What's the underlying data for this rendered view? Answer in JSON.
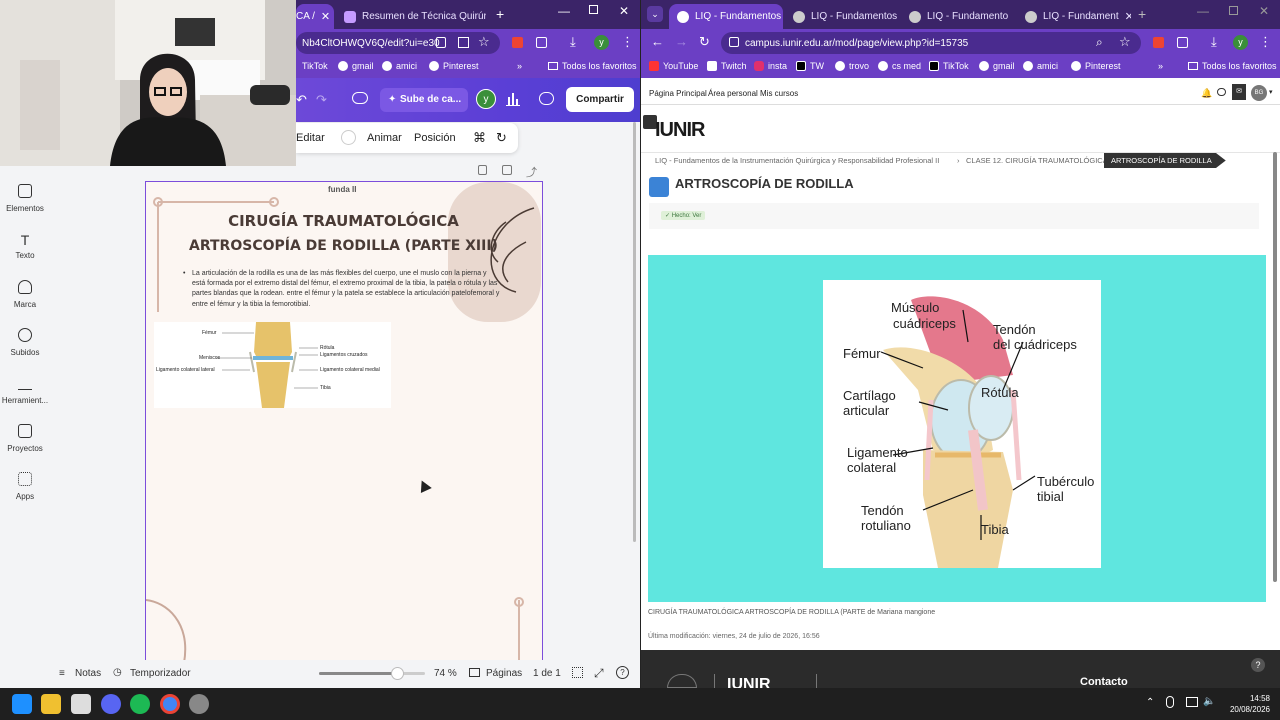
{
  "left_browser": {
    "tabs": [
      {
        "label": "CA /"
      },
      {
        "label": "Resumen de Técnica Quirúrgica"
      }
    ],
    "new_tab": "+",
    "address": "Nb4CltOHWQV6Q/edit?ui=e30",
    "profile": "y",
    "bookmarks": [
      "TikTok",
      "gmail",
      "amici",
      "Pinterest"
    ],
    "all_bookmarks": "Todos los favoritos"
  },
  "canva": {
    "upload_label": "Sube de ca...",
    "avatar": "y",
    "share_label": "Compartir",
    "edit_label": "Editar",
    "animate_label": "Animar",
    "position_label": "Posición",
    "sidebar": [
      {
        "label": "Elementos",
        "icon": "elements-icon"
      },
      {
        "label": "Texto",
        "icon": "text-icon"
      },
      {
        "label": "Marca",
        "icon": "brand-icon"
      },
      {
        "label": "Subidos",
        "icon": "uploads-icon"
      },
      {
        "label": "Herramient...",
        "icon": "tools-icon"
      },
      {
        "label": "Proyectos",
        "icon": "projects-icon"
      },
      {
        "label": "Apps",
        "icon": "apps-icon"
      }
    ],
    "page": {
      "header": "funda II",
      "title_line1": "CIRUGÍA TRAUMATOLÓGICA",
      "title_line2": "ARTROSCOPÍA DE RODILLA (PARTE XIII)",
      "bullet": "La articulación de la rodilla es una de las más flexibles del cuerpo, une el muslo con la pierna y está formada por el extremo distal del fémur, el extremo proximal de la tibia, la patela o rótula y las partes blandas que la rodean. entre el fémur y la patela se establece la articulación patelofemoral y entre el fémur y la tibia la femorotibial.",
      "diagram_labels": {
        "femur": "Fémur",
        "meniscos": "Meniscos",
        "lig_col_lat": "Ligamento colateral lateral",
        "rotula": "Rótula",
        "lig_cruzados": "Ligamentos cruzados",
        "lig_col_med": "Ligamento colateral medial",
        "tibia": "Tibia"
      }
    },
    "bottom": {
      "notes": "Notas",
      "timer": "Temporizador",
      "zoom_value": 0.74,
      "zoom": "74 %",
      "pages": "Páginas",
      "page_count": "1 de 1"
    }
  },
  "right_browser": {
    "tabs": [
      {
        "label": "LIQ - Fundamentos"
      },
      {
        "label": "LIQ - Fundamentos"
      },
      {
        "label": "LIQ - Fundamento"
      },
      {
        "label": "LIQ - Fundament"
      }
    ],
    "new_tab": "+",
    "address": "campus.iunir.edu.ar/mod/page/view.php?id=15735",
    "profile": "y",
    "bookmarks": [
      "YouTube",
      "Twitch",
      "insta",
      "TW",
      "trovo",
      "cs med",
      "TikTok",
      "gmail",
      "amici",
      "Pinterest"
    ],
    "all_bookmarks": "Todos los favoritos"
  },
  "moodle": {
    "nav": [
      "Página Principal",
      "Área personal",
      "Mis cursos"
    ],
    "user_initials": "BG",
    "logo": "IUNIR",
    "breadcrumbs": [
      "LIQ - Fundamentos de la Instrumentación Quirúrgica y Responsabilidad Profesional II",
      "CLASE 12. CIRUGÍA TRAUMATOLÓGICA",
      "ARTROSCOPÍA DE RODILLA"
    ],
    "title": "ARTROSCOPÍA DE RODILLA",
    "done_badge": "✓ Hecho: Ver",
    "knee_labels": {
      "musculo": "Músculo",
      "cuadriceps": "cuádriceps",
      "tendon": "Tendón",
      "del_cuadriceps": "del cuádriceps",
      "femur": "Fémur",
      "cartilago": "Cartílago",
      "articular": "articular",
      "rotula": "Rótula",
      "ligamento": "Ligamento",
      "colateral": "colateral",
      "tuberculo": "Tubérculo",
      "tibial": "tibial",
      "tendon2": "Tendón",
      "rotuliano": "rotuliano",
      "tibia": "Tibia"
    },
    "caption_main": "CIRUGÍA TRAUMATOLÓGICA ARTROSCOPÍA DE RODILLA (PARTE",
    "caption_by": " de Mariana mangione",
    "modified": "Última modificación: viernes, 24 de julio de 2026, 16:56",
    "footer_contact": "Contacto",
    "footer_logo": "IUNIR"
  },
  "taskbar": {
    "time": "14:58",
    "date": "20/08/2026"
  },
  "colors": {
    "purple_dark": "#3b2468",
    "purple": "#6b3fc4",
    "teal": "#5fe6df",
    "canva_page": "#fcf6f2"
  }
}
